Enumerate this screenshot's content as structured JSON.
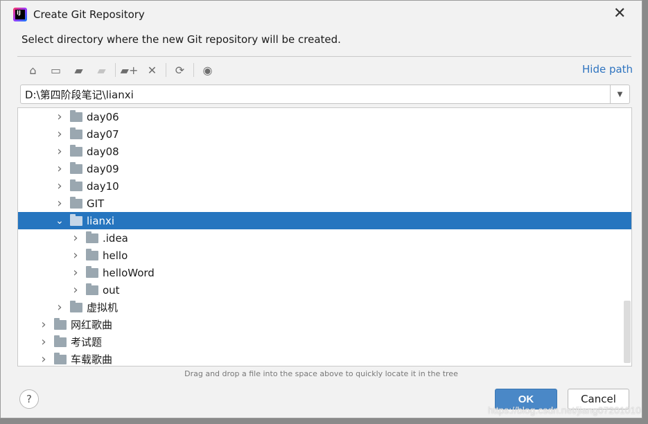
{
  "dialog": {
    "title": "Create Git Repository",
    "description": "Select directory where the new Git repository will be created."
  },
  "toolbar": {
    "icons": [
      "home-icon",
      "desktop-icon",
      "project-folder-icon",
      "module-folder-icon",
      "new-folder-icon",
      "delete-icon",
      "refresh-icon",
      "show-hidden-icon"
    ],
    "hide_path": "Hide path"
  },
  "path": {
    "value": "D:\\第四阶段笔记\\lianxi"
  },
  "tree": [
    {
      "label": "day06",
      "level": 2,
      "expanded": false
    },
    {
      "label": "day07",
      "level": 2,
      "expanded": false
    },
    {
      "label": "day08",
      "level": 2,
      "expanded": false
    },
    {
      "label": "day09",
      "level": 2,
      "expanded": false
    },
    {
      "label": "day10",
      "level": 2,
      "expanded": false
    },
    {
      "label": "GIT",
      "level": 2,
      "expanded": false
    },
    {
      "label": "lianxi",
      "level": 2,
      "expanded": true,
      "selected": true
    },
    {
      "label": ".idea",
      "level": 3,
      "expanded": false
    },
    {
      "label": "hello",
      "level": 3,
      "expanded": false
    },
    {
      "label": "helloWord",
      "level": 3,
      "expanded": false
    },
    {
      "label": "out",
      "level": 3,
      "expanded": false
    },
    {
      "label": "虚拟机",
      "level": 2,
      "expanded": false
    },
    {
      "label": "网红歌曲",
      "level": 1,
      "expanded": false
    },
    {
      "label": "考试题",
      "level": 1,
      "expanded": false
    },
    {
      "label": "车载歌曲",
      "level": 1,
      "expanded": false
    }
  ],
  "hint": "Drag and drop a file into the space above to quickly locate it in the tree",
  "buttons": {
    "help": "?",
    "ok": "OK",
    "cancel": "Cancel"
  },
  "watermark": "https://blog.csdn.net/jiang07201010",
  "colors": {
    "selection": "#2675bf",
    "ok_button": "#4a88c7",
    "link": "#2f74c0"
  }
}
